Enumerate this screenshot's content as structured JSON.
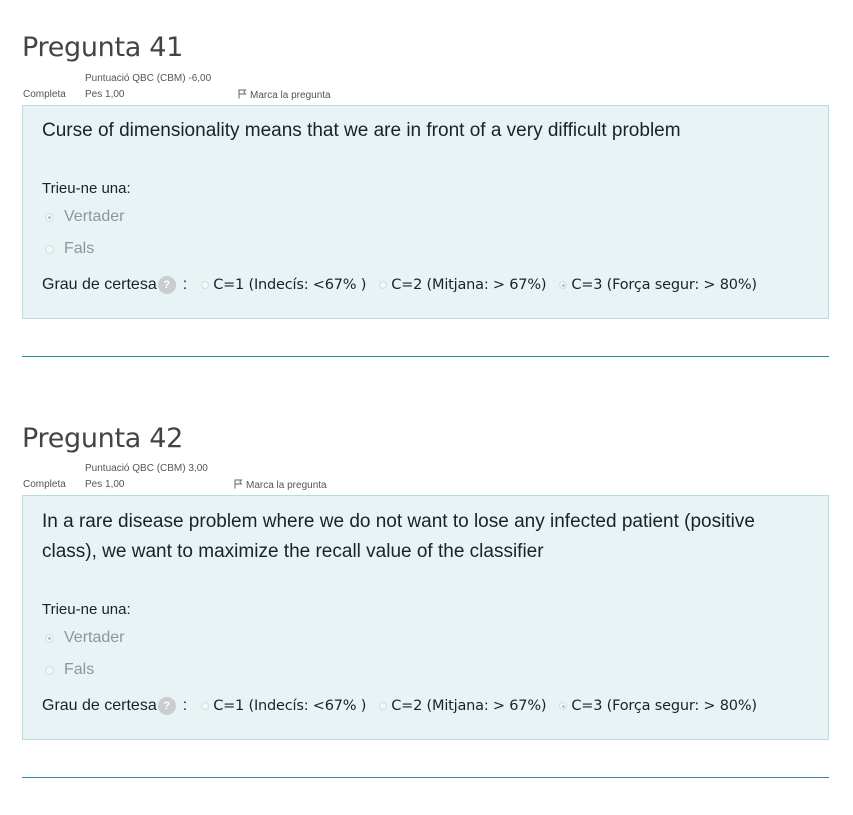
{
  "questions": [
    {
      "title": "Pregunta 41",
      "status": "Completa",
      "score": "Puntuació QBC (CBM) -6,00",
      "weight": "Pes 1,00",
      "flag": "Marca la pregunta",
      "text": "Curse of dimensionality means that we are in front of a very difficult problem",
      "prompt": "Trieu-ne una:",
      "answers": [
        {
          "label": "Vertader",
          "selected": true
        },
        {
          "label": "Fals",
          "selected": false
        }
      ],
      "certainty_label": "Grau de certesa",
      "help_icon": "?",
      "colon": ":",
      "certainty_options": [
        {
          "label": "C=1 (Indecís: <67% )",
          "selected": false
        },
        {
          "label": "C=2 (Mitjana: > 67%)",
          "selected": false
        },
        {
          "label": "C=3 (Força segur: > 80%)",
          "selected": true
        }
      ]
    },
    {
      "title": "Pregunta 42",
      "status": "Completa",
      "score": "Puntuació QBC (CBM) 3,00",
      "weight": "Pes 1,00",
      "flag": "Marca la pregunta",
      "text": "In a rare disease problem where we do not want to lose any infected patient (positive class), we want to maximize the recall value of the classifier",
      "prompt": "Trieu-ne una:",
      "answers": [
        {
          "label": "Vertader",
          "selected": true
        },
        {
          "label": "Fals",
          "selected": false
        }
      ],
      "certainty_label": "Grau de certesa",
      "help_icon": "?",
      "colon": ":",
      "certainty_options": [
        {
          "label": "C=1 (Indecís: <67% )",
          "selected": false
        },
        {
          "label": "C=2 (Mitjana: > 67%)",
          "selected": false
        },
        {
          "label": "C=3 (Força segur: > 80%)",
          "selected": true
        }
      ]
    }
  ]
}
